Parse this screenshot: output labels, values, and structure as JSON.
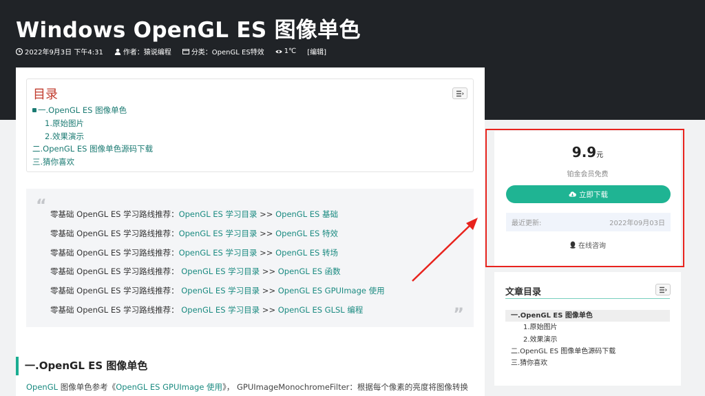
{
  "header": {
    "title": "Windows OpenGL ES 图像单色",
    "meta": {
      "date": "2022年9月3日 下午4:31",
      "author": "作者：猿说编程",
      "category": "分类：OpenGL ES特效",
      "views": "1℃",
      "edit": "[编辑]"
    }
  },
  "toc": {
    "title": "目录",
    "items": [
      {
        "label": "一.OpenGL ES 图像单色",
        "level": 1
      },
      {
        "label": "1.原始图片",
        "level": 2
      },
      {
        "label": "2.效果演示",
        "level": 2
      },
      {
        "label": "二.OpenGL ES 图像单色源码下载",
        "level": 1
      },
      {
        "label": "三.猜你喜欢",
        "level": 1
      }
    ]
  },
  "quote": {
    "lines": [
      {
        "prefix": "零基础 OpenGL ES 学习路线推荐：",
        "link1": "OpenGL ES 学习目录",
        "sep": " >> ",
        "link2": "OpenGL ES 基础"
      },
      {
        "prefix": "零基础 OpenGL ES 学习路线推荐：",
        "link1": "OpenGL ES 学习目录",
        "sep": "  >> ",
        "link2": "OpenGL ES 特效"
      },
      {
        "prefix": "零基础 OpenGL ES 学习路线推荐：",
        "link1": "OpenGL ES 学习目录",
        "sep": "  >> ",
        "link2": "OpenGL ES 转场"
      },
      {
        "prefix": "零基础 OpenGL ES 学习路线推荐： ",
        "link1": "OpenGL ES 学习目录",
        "sep": " >> ",
        "link2": "OpenGL ES 函数"
      },
      {
        "prefix": "零基础 OpenGL ES 学习路线推荐： ",
        "link1": "OpenGL ES 学习目录",
        "sep": " >> ",
        "link2": "OpenGL ES GPUImage 使用"
      },
      {
        "prefix": "零基础 OpenGL ES 学习路线推荐： ",
        "link1": "OpenGL ES 学习目录",
        "sep": " >> ",
        "link2": "OpenGL ES GLSL 编程"
      }
    ]
  },
  "section": {
    "heading": "一.OpenGL ES 图像单色",
    "para_link1": "OpenGL",
    "para_text1": " 图像单色参考《",
    "para_link2": "OpenGL ES GPUImage 使用",
    "para_text2": "》， GPUImageMonochromeFilter：根据每个像素的亮度将图像转换"
  },
  "download": {
    "price": "9.9",
    "price_unit": "元",
    "vip_text": "铂金会员免费",
    "button": "立即下载",
    "update_label": "最近更新:",
    "update_date": "2022年09月03日",
    "consult": "在线咨询"
  },
  "side_toc": {
    "title": "文章目录",
    "items": [
      {
        "label": "一.OpenGL ES 图像单色",
        "level": 1,
        "active": true
      },
      {
        "label": "1.原始图片",
        "level": 2
      },
      {
        "label": "2.效果演示",
        "level": 2
      },
      {
        "label": "二.OpenGL ES 图像单色源码下载",
        "level": 1
      },
      {
        "label": "三.猜你喜欢",
        "level": 1
      }
    ]
  },
  "colors": {
    "accent": "#1fb493",
    "highlight": "#e8231d",
    "hero_bg": "#202327"
  }
}
